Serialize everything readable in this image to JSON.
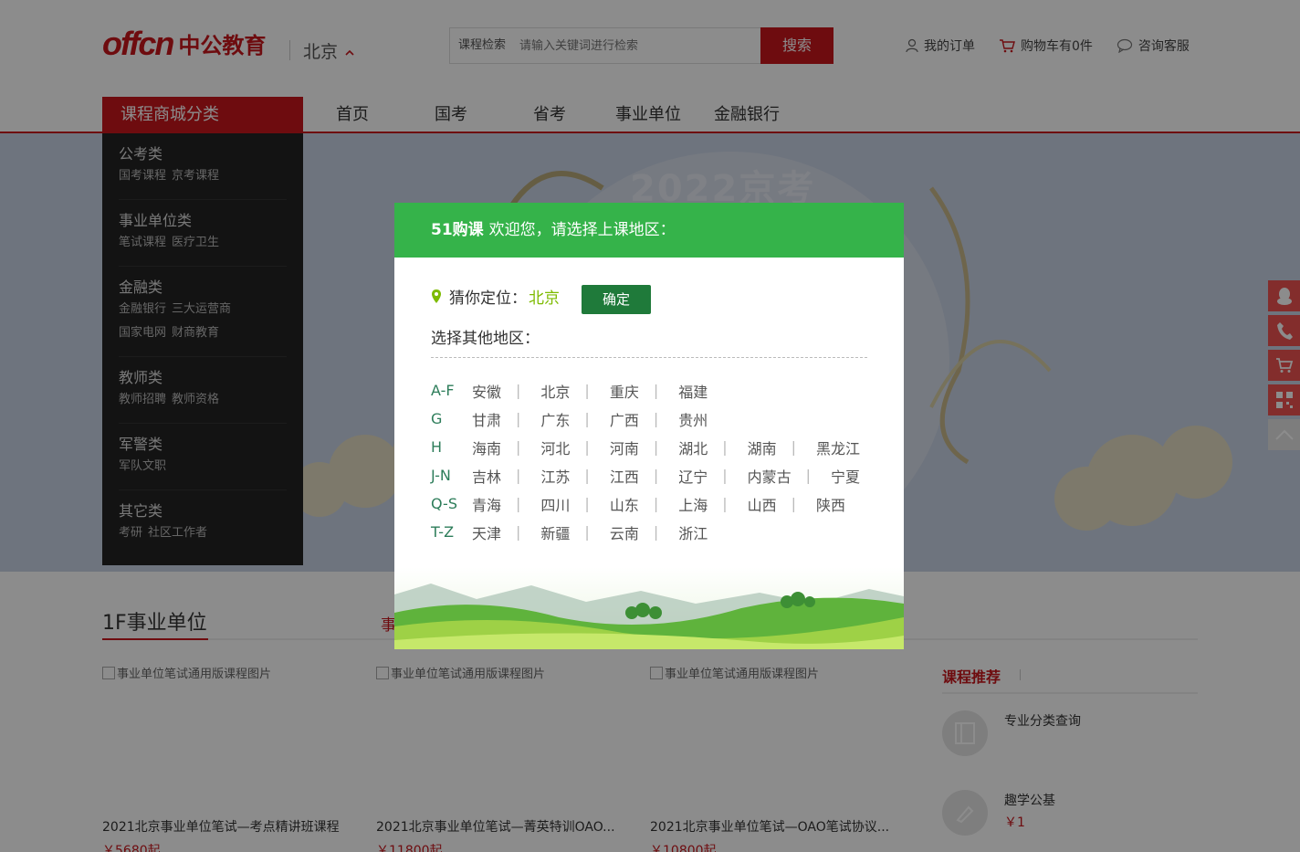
{
  "header": {
    "logo_en": "offcn",
    "logo_cn": "中公教育",
    "city": "北京",
    "search_category": "课程检索",
    "search_placeholder": "请输入关键词进行检索",
    "search_button": "搜索",
    "links": {
      "orders": "我的订单",
      "cart": "购物车有0件",
      "service": "咨询客服"
    }
  },
  "nav": {
    "category_title": "课程商城分类",
    "links": [
      "首页",
      "国考",
      "省考",
      "事业单位",
      "金融银行"
    ]
  },
  "banner": {
    "title": "2022京考"
  },
  "categories": [
    {
      "title": "公考类",
      "subs": [
        "国考课程",
        "京考课程"
      ]
    },
    {
      "title": "事业单位类",
      "subs": [
        "笔试课程",
        "医疗卫生"
      ]
    },
    {
      "title": "金融类",
      "subs": [
        "金融银行",
        "三大运营商",
        "国家电网",
        "财商教育"
      ]
    },
    {
      "title": "教师类",
      "subs": [
        "教师招聘",
        "教师资格"
      ]
    },
    {
      "title": "军警类",
      "subs": [
        "军队文职"
      ]
    },
    {
      "title": "其它类",
      "subs": [
        "考研",
        "社区工作者"
      ]
    }
  ],
  "modal": {
    "brand": "51购课",
    "welcome": "欢迎您，请选择上课地区：",
    "guess_label": "猜你定位：",
    "guess_city": "北京",
    "confirm": "确定",
    "other_label": "选择其他地区：",
    "regions": [
      {
        "key": "A-F",
        "cities": [
          "安徽",
          "北京",
          "重庆",
          "福建"
        ]
      },
      {
        "key": "G",
        "cities": [
          "甘肃",
          "广东",
          "广西",
          "贵州"
        ]
      },
      {
        "key": "H",
        "cities": [
          "海南",
          "河北",
          "河南",
          "湖北",
          "湖南",
          "黑龙江"
        ]
      },
      {
        "key": "J-N",
        "cities": [
          "吉林",
          "江苏",
          "江西",
          "辽宁",
          "内蒙古",
          "宁夏"
        ]
      },
      {
        "key": "Q-S",
        "cities": [
          "青海",
          "四川",
          "山东",
          "上海",
          "山西",
          "陕西"
        ]
      },
      {
        "key": "T-Z",
        "cities": [
          "天津",
          "新疆",
          "云南",
          "浙江"
        ]
      }
    ]
  },
  "floor": {
    "title": "1F事业单位",
    "tab": "事",
    "courses": [
      {
        "img_alt": "事业单位笔试通用版课程图片",
        "name": "2021北京事业单位笔试—考点精讲班课程",
        "price": "￥5680起"
      },
      {
        "img_alt": "事业单位笔试通用版课程图片",
        "name": "2021北京事业单位笔试—菁英特训OAO...",
        "price": "￥11800起"
      },
      {
        "img_alt": "事业单位笔试通用版课程图片",
        "name": "2021北京事业单位笔试—OAO笔试协议...",
        "price": "￥10800起"
      }
    ],
    "reco_title": "课程推荐",
    "reco": [
      {
        "name": "专业分类查询",
        "price": ""
      },
      {
        "name": "趣学公基",
        "price": "￥1"
      }
    ]
  },
  "colors": {
    "brand_red": "#c8161d",
    "modal_green": "#35b34a",
    "confirm_green": "#1f7a3a",
    "float_red": "#ef5350"
  }
}
